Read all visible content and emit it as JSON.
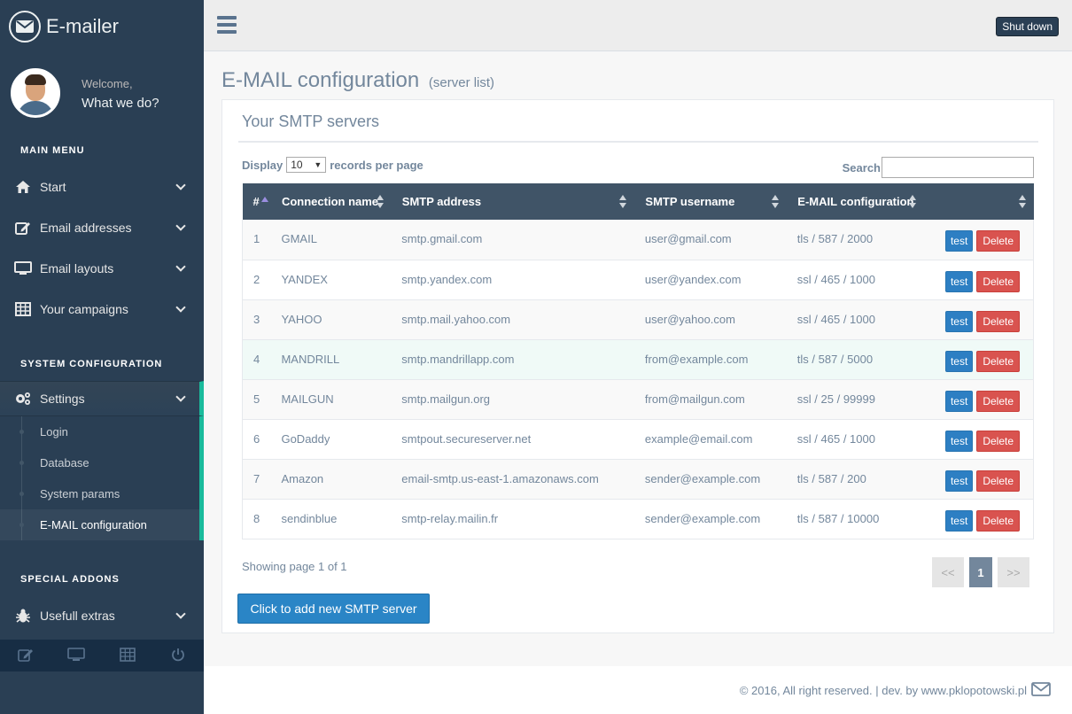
{
  "brand": {
    "title": "E-mailer",
    "icon": "envelope-icon"
  },
  "profile": {
    "welcome": "Welcome,",
    "name": "What we do?"
  },
  "sidebar": {
    "main_menu_title": "MAIN MENU",
    "main_items": [
      {
        "label": "Start",
        "icon": "home-icon"
      },
      {
        "label": "Email addresses",
        "icon": "edit-icon"
      },
      {
        "label": "Email layouts",
        "icon": "desktop-icon"
      },
      {
        "label": "Your campaigns",
        "icon": "table-icon"
      }
    ],
    "system_title": "SYSTEM CONFIGURATION",
    "settings_label": "Settings",
    "settings_sub": [
      "Login",
      "Database",
      "System params",
      "E-MAIL configuration"
    ],
    "addons_title": "SPECIAL ADDONS",
    "extras_label": "Usefull extras",
    "footer_icons": [
      "edit-icon",
      "desktop-icon",
      "table-icon",
      "power-icon"
    ]
  },
  "topnav": {
    "shutdown_label": "Shut down"
  },
  "page": {
    "title": "E-MAIL configuration",
    "subtitle": "(server list)",
    "panel_title": "Your SMTP servers",
    "display_label": "Display",
    "display_value": "10",
    "records_label": "records per page",
    "search_label": "Search",
    "search_value": ""
  },
  "table": {
    "headers": [
      "#",
      "Connection name",
      "SMTP address",
      "SMTP username",
      "E-MAIL configuration",
      ""
    ],
    "rows": [
      {
        "num": "1",
        "name": "GMAIL",
        "address": "smtp.gmail.com",
        "username": "user@gmail.com",
        "config": "tls / 587 / 2000"
      },
      {
        "num": "2",
        "name": "YANDEX",
        "address": "smtp.yandex.com",
        "username": "user@yandex.com",
        "config": "ssl / 465 / 1000"
      },
      {
        "num": "3",
        "name": "YAHOO",
        "address": "smtp.mail.yahoo.com",
        "username": "user@yahoo.com",
        "config": "ssl / 465 / 1000"
      },
      {
        "num": "4",
        "name": "MANDRILL",
        "address": "smtp.mandrillapp.com",
        "username": "from@example.com",
        "config": "tls / 587 / 5000"
      },
      {
        "num": "5",
        "name": "MAILGUN",
        "address": "smtp.mailgun.org",
        "username": "from@mailgun.com",
        "config": "ssl / 25 / 99999"
      },
      {
        "num": "6",
        "name": "GoDaddy",
        "address": "smtpout.secureserver.net",
        "username": "example@email.com",
        "config": "ssl / 465 / 1000"
      },
      {
        "num": "7",
        "name": "Amazon",
        "address": "email-smtp.us-east-1.amazonaws.com",
        "username": "sender@example.com",
        "config": "tls / 587 / 200"
      },
      {
        "num": "8",
        "name": "sendinblue",
        "address": "smtp-relay.mailin.fr",
        "username": "sender@example.com",
        "config": "tls / 587 / 10000"
      }
    ],
    "test_label": "test",
    "delete_label": "Delete"
  },
  "pagination": {
    "showing": "Showing page 1 of 1",
    "prev": "<<",
    "current": "1",
    "next": ">>"
  },
  "add_button_label": "Click to add new SMTP server",
  "footer": {
    "text": "© 2016, All right reserved. | dev. by www.pklopotowski.pl"
  },
  "colors": {
    "sidebar": "#2a3f54",
    "accent": "#1abb9c",
    "table_header": "#405467",
    "primary": "#2a85c6",
    "danger": "#d9534f"
  }
}
